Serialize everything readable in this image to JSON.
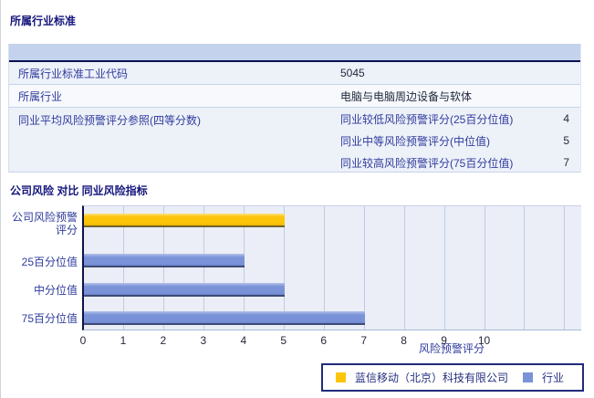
{
  "sections": {
    "industry_standard_title": "所属行业标准",
    "comparison_title": "公司风险 对比 同业风险指标"
  },
  "table": {
    "rows": [
      {
        "label": "所属行业标准工业代码",
        "value": "5045"
      },
      {
        "label": "所属行业",
        "value": "电脑与电脑周边设备与软体"
      },
      {
        "label": "同业平均风险预警评分参照(四等分数)",
        "sub_rows": [
          {
            "label": "同业较低风险预警评分(25百分位值)",
            "value": "4"
          },
          {
            "label": "同业中等风险预警评分(中位值)",
            "value": "5"
          },
          {
            "label": "同业较高风险预警评分(75百分位值)",
            "value": "7"
          }
        ]
      }
    ]
  },
  "chart_data": {
    "type": "bar",
    "orientation": "horizontal",
    "title": "公司风险 对比 同业风险指标",
    "categories": [
      "公司风险预警评分",
      "25百分位值",
      "中分位值",
      "75百分位值"
    ],
    "values": [
      5,
      4,
      5,
      7
    ],
    "series_of_bar": [
      "company",
      "industry",
      "industry",
      "industry"
    ],
    "xlabel": "风险预警评分",
    "x_ticks": [
      0,
      1,
      2,
      3,
      4,
      5,
      6,
      7,
      8,
      9,
      10
    ],
    "xlim": [
      0,
      12.4
    ],
    "grid": true,
    "legend_position": "bottom-right",
    "legend": [
      {
        "label": "蓝信移动（北京）科技有限公司",
        "color": "#fdc50a",
        "series": "company"
      },
      {
        "label": "行业",
        "color": "#7a93d8",
        "series": "industry"
      }
    ]
  },
  "colors": {
    "company_bar": "#fdc50a",
    "industry_bar": "#7a93d8",
    "table_header_band": "#c4d2ed",
    "title_text": "#15157d",
    "label_text": "#2f3b9d"
  }
}
